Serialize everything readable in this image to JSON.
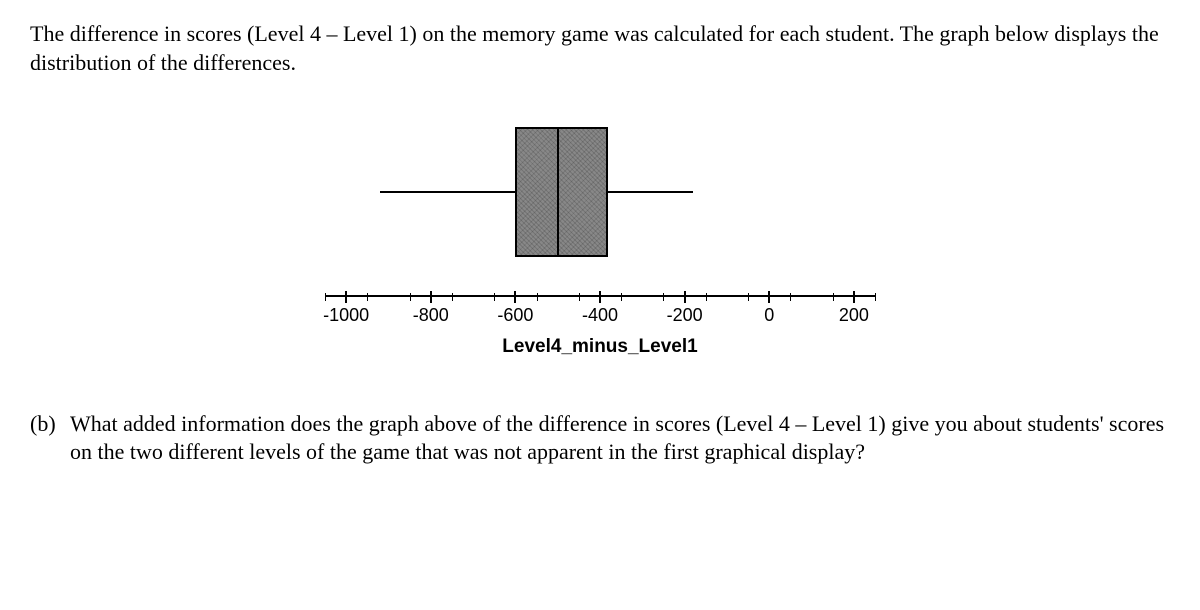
{
  "intro_text": "The difference in scores (Level 4 – Level 1) on the memory game was calculated for each student. The graph below displays the distribution of the differences.",
  "question_label": "(b)",
  "question_text": "What added information does the graph above of the difference in scores (Level 4 – Level 1) give you about students' scores on the two different levels of the game that was not apparent in the first graphical display?",
  "chart_data": {
    "type": "boxplot",
    "xlabel": "Level4_minus_Level1",
    "xlim": [
      -1050,
      250
    ],
    "ticks": [
      -1000,
      -800,
      -600,
      -400,
      -200,
      0,
      200
    ],
    "minor_step": 100,
    "min_whisker": -920,
    "q1": -600,
    "median": -500,
    "q3": -380,
    "max_whisker": -180
  }
}
